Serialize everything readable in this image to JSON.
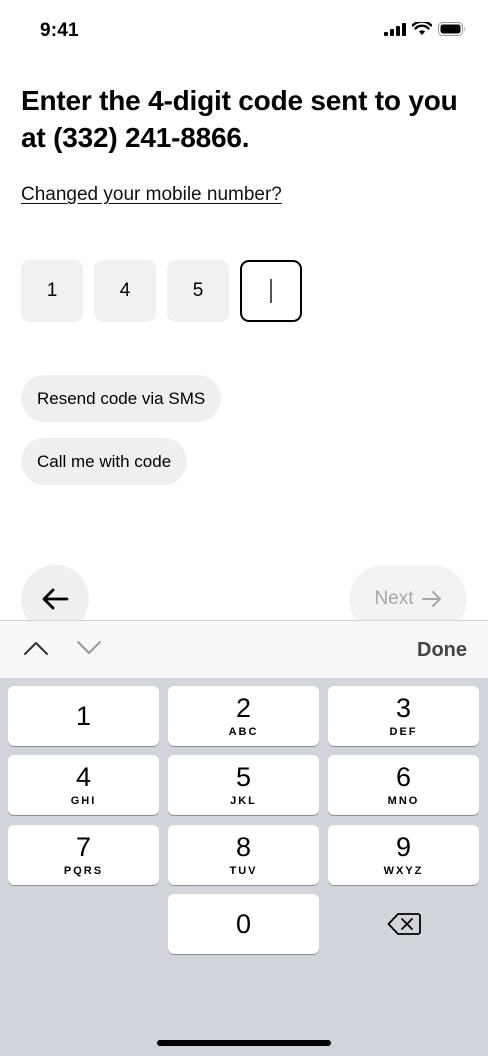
{
  "status_bar": {
    "time": "9:41"
  },
  "heading": "Enter the 4-digit code sent to you at (332) 241-8866.",
  "changed_number_link": "Changed your mobile number?",
  "code": {
    "digits": [
      "1",
      "4",
      "5",
      ""
    ],
    "active_index": 3
  },
  "actions": {
    "resend_sms": "Resend code via SMS",
    "call_me": "Call me with code"
  },
  "navigation": {
    "next_label": "Next",
    "next_enabled": false
  },
  "keyboard_accessory": {
    "done_label": "Done"
  },
  "keypad": {
    "keys": [
      {
        "digit": "1",
        "letters": ""
      },
      {
        "digit": "2",
        "letters": "ABC"
      },
      {
        "digit": "3",
        "letters": "DEF"
      },
      {
        "digit": "4",
        "letters": "GHI"
      },
      {
        "digit": "5",
        "letters": "JKL"
      },
      {
        "digit": "6",
        "letters": "MNO"
      },
      {
        "digit": "7",
        "letters": "PQRS"
      },
      {
        "digit": "8",
        "letters": "TUV"
      },
      {
        "digit": "9",
        "letters": "WXYZ"
      },
      {
        "digit": "0",
        "letters": ""
      }
    ]
  },
  "icons": {
    "back": "arrow-left-icon",
    "next": "arrow-right-icon",
    "delete": "backspace-icon",
    "prev_field": "chevron-up-icon",
    "next_field": "chevron-down-icon",
    "signal": "cellular-signal-icon",
    "wifi": "wifi-icon",
    "battery": "battery-icon"
  },
  "colors": {
    "accent": "#000000",
    "pill_bg": "#efefef",
    "disabled_text": "#a7a7a7",
    "keyboard_bg": "#d1d4da"
  }
}
